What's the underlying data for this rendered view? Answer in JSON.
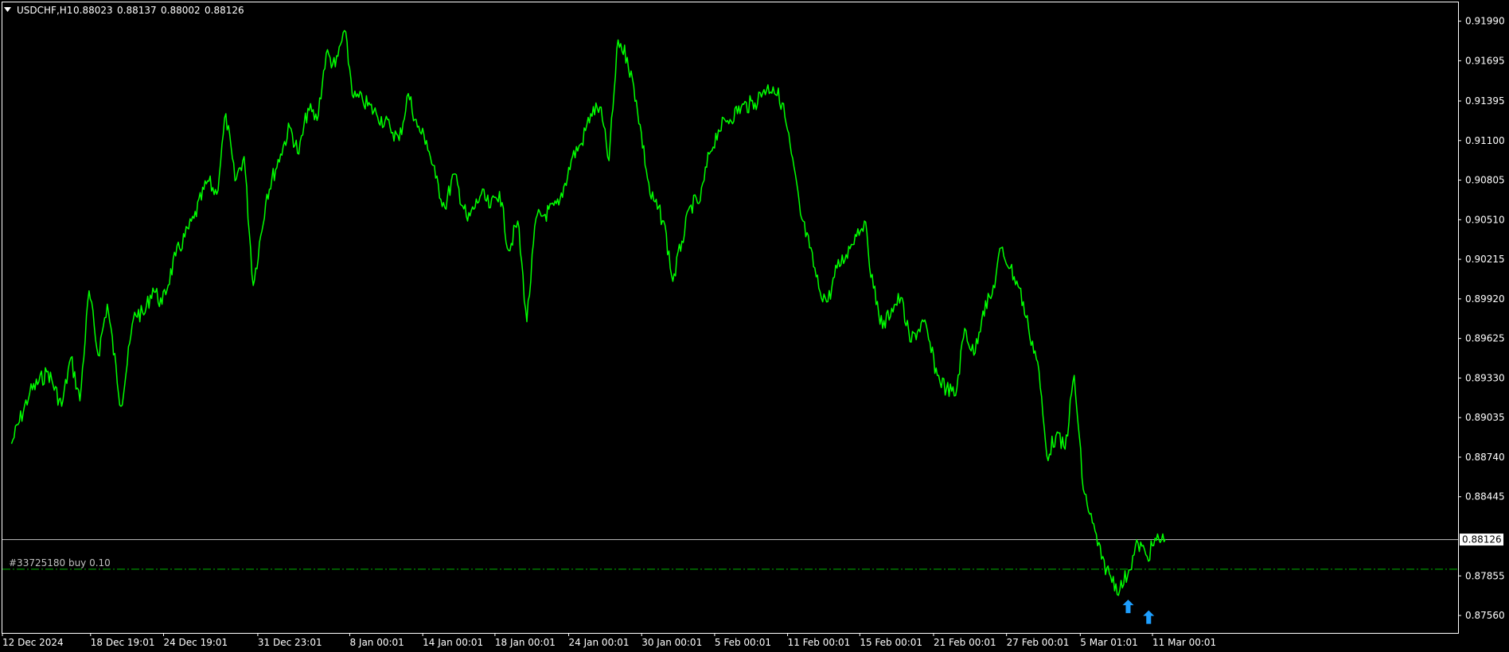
{
  "header": {
    "symbol": "USDCHF,H1",
    "open": "0.88023",
    "high": "0.88137",
    "low": "0.88002",
    "close": "0.88126",
    "menu_icon": "triangle-down-icon"
  },
  "colors": {
    "background": "#000000",
    "price_line": "#00ff00",
    "frame": "#ffffff",
    "bid_line": "#c0c0c0",
    "order_line": "#00b000",
    "arrow": "#1e9fff"
  },
  "order": {
    "label": "#33725180 buy 0.10",
    "price": 0.87905
  },
  "current_price": {
    "label": "0.88126",
    "value": 0.88126
  },
  "arrows": [
    {
      "name": "buy-arrow-icon",
      "date": "2025-03-07T17:00",
      "price": 0.87625
    },
    {
      "name": "buy-arrow-icon",
      "date": "2025-03-10T20:00",
      "price": 0.87545
    }
  ],
  "chart_data": {
    "type": "line",
    "symbol": "USDCHF",
    "timeframe": "H1",
    "ylim": [
      0.8743,
      0.9213
    ],
    "grid": false,
    "y_ticks": [
      "0.91990",
      "0.91695",
      "0.91395",
      "0.91100",
      "0.90805",
      "0.90510",
      "0.90215",
      "0.89920",
      "0.89625",
      "0.89330",
      "0.89035",
      "0.88740",
      "0.88445",
      "0.87855",
      "0.87560"
    ],
    "x_ticks": [
      "12 Dec 2024",
      "18 Dec 19:01",
      "24 Dec 19:01",
      "31 Dec 23:01",
      "8 Jan 00:01",
      "14 Jan 00:01",
      "18 Jan 00:01",
      "24 Jan 00:01",
      "30 Jan 00:01",
      "5 Feb 00:01",
      "11 Feb 00:01",
      "15 Feb 00:01",
      "21 Feb 00:01",
      "27 Feb 00:01",
      "5 Mar 01:01",
      "11 Mar 00:01"
    ],
    "series": [
      {
        "x": [
          "2024-12-12",
          "2024-12-13",
          "2024-12-16",
          "2024-12-17",
          "2024-12-17",
          "2024-12-18",
          "2024-12-18",
          "2024-12-19",
          "2024-12-19",
          "2024-12-20",
          "2024-12-23",
          "2024-12-23",
          "2024-12-24",
          "2024-12-24",
          "2024-12-25",
          "2024-12-26",
          "2024-12-27",
          "2024-12-27",
          "2024-12-30",
          "2024-12-30",
          "2024-12-31",
          "2024-12-31",
          "2025-01-01",
          "2025-01-02",
          "2025-01-02",
          "2025-01-03",
          "2025-01-03",
          "2025-01-06",
          "2025-01-06",
          "2025-01-07",
          "2025-01-07",
          "2025-01-08",
          "2025-01-08",
          "2025-01-09",
          "2025-01-10",
          "2025-01-10",
          "2025-01-13",
          "2025-01-13",
          "2025-01-14",
          "2025-01-14",
          "2025-01-15",
          "2025-01-15",
          "2025-01-16",
          "2025-01-17",
          "2025-01-17",
          "2025-01-20",
          "2025-01-20",
          "2025-01-21",
          "2025-01-21",
          "2025-01-22",
          "2025-01-22",
          "2025-01-23",
          "2025-01-24",
          "2025-01-24",
          "2025-01-27",
          "2025-01-27",
          "2025-01-28",
          "2025-01-28",
          "2025-01-29",
          "2025-01-29",
          "2025-01-30",
          "2025-01-31",
          "2025-01-31",
          "2025-02-03",
          "2025-02-03",
          "2025-02-04",
          "2025-02-04",
          "2025-02-05",
          "2025-02-05",
          "2025-02-06",
          "2025-02-07",
          "2025-02-07",
          "2025-02-10",
          "2025-02-10",
          "2025-02-11",
          "2025-02-11",
          "2025-02-12",
          "2025-02-12",
          "2025-02-13",
          "2025-02-13",
          "2025-02-14",
          "2025-02-14",
          "2025-02-17",
          "2025-02-17",
          "2025-02-18",
          "2025-02-18",
          "2025-02-19",
          "2025-02-19",
          "2025-02-20",
          "2025-02-21",
          "2025-02-21",
          "2025-02-24",
          "2025-02-24",
          "2025-02-25",
          "2025-02-25",
          "2025-02-26",
          "2025-02-26",
          "2025-02-27",
          "2025-02-27",
          "2025-02-28",
          "2025-02-28",
          "2025-03-03",
          "2025-03-03",
          "2025-03-04",
          "2025-03-04",
          "2025-03-05",
          "2025-03-05",
          "2025-03-06",
          "2025-03-06",
          "2025-03-07",
          "2025-03-07",
          "2025-03-10",
          "2025-03-10",
          "2025-03-11",
          "2025-03-11"
        ],
        "values": [
          0.8884,
          0.8922,
          0.8938,
          0.8912,
          0.8948,
          0.8916,
          0.8998,
          0.895,
          0.8988,
          0.8912,
          0.8982,
          0.898,
          0.9,
          0.8988,
          0.9024,
          0.9052,
          0.908,
          0.907,
          0.913,
          0.908,
          0.9098,
          0.9002,
          0.907,
          0.91,
          0.912,
          0.91,
          0.9134,
          0.9125,
          0.9175,
          0.9165,
          0.9192,
          0.9142,
          0.914,
          0.913,
          0.912,
          0.911,
          0.9145,
          0.912,
          0.911,
          0.9082,
          0.906,
          0.9085,
          0.905,
          0.907,
          0.906,
          0.9072,
          0.9028,
          0.905,
          0.8975,
          0.9052,
          0.9055,
          0.9062,
          0.9098,
          0.9108,
          0.913,
          0.9135,
          0.9095,
          0.9185,
          0.9172,
          0.914,
          0.907,
          0.905,
          0.9005,
          0.9035,
          0.9062,
          0.9065,
          0.91,
          0.9118,
          0.9125,
          0.9135,
          0.9138,
          0.9148,
          0.915,
          0.9138,
          0.91,
          0.9055,
          0.903,
          0.9,
          0.899,
          0.9015,
          0.9025,
          0.904,
          0.905,
          0.9,
          0.897,
          0.8985,
          0.8993,
          0.896,
          0.8975,
          0.8935,
          0.8925,
          0.892,
          0.897,
          0.895,
          0.8983,
          0.8995,
          0.903,
          0.9015,
          0.9,
          0.897,
          0.8945,
          0.8875,
          0.889,
          0.888,
          0.8935,
          0.885,
          0.8825,
          0.8798,
          0.8785,
          0.8775,
          0.879,
          0.881,
          0.88,
          0.8812,
          0.8813
        ]
      }
    ]
  }
}
